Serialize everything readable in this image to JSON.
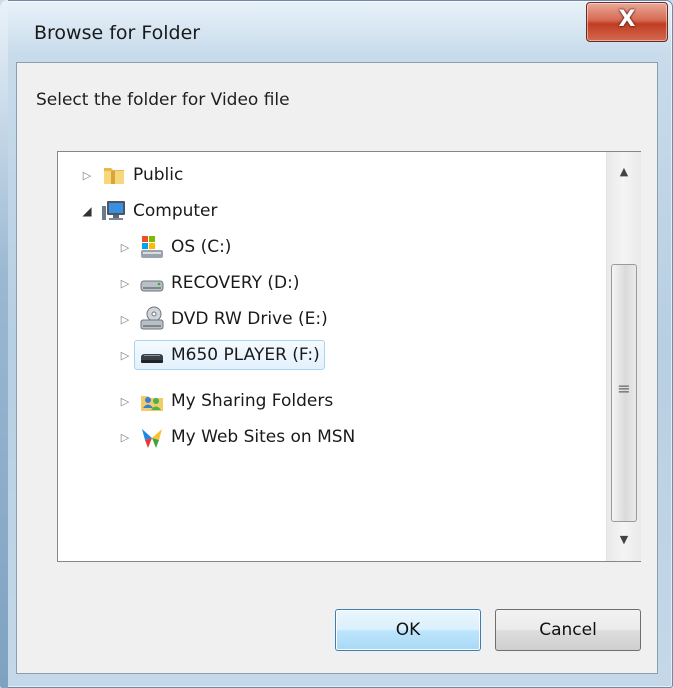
{
  "window": {
    "title": "Browse for Folder",
    "close_glyph": "X"
  },
  "dialog": {
    "prompt": "Select the folder for Video file"
  },
  "tree": {
    "items": [
      {
        "label": "Public",
        "icon": "folder-icon",
        "expander": "collapsed",
        "level": 0
      },
      {
        "label": "Computer",
        "icon": "computer-icon",
        "expander": "expanded",
        "level": 0
      },
      {
        "label": "OS (C:)",
        "icon": "windows-drive-icon",
        "expander": "collapsed",
        "level": 1
      },
      {
        "label": "RECOVERY (D:)",
        "icon": "hard-drive-icon",
        "expander": "collapsed",
        "level": 1
      },
      {
        "label": "DVD RW Drive (E:)",
        "icon": "dvd-drive-icon",
        "expander": "collapsed",
        "level": 1
      },
      {
        "label": "M650 PLAYER (F:)",
        "icon": "removable-drive-icon",
        "expander": "collapsed",
        "level": 1,
        "selected": true
      },
      {
        "label": "My Sharing Folders",
        "icon": "sharing-folders-icon",
        "expander": "collapsed",
        "level": 1
      },
      {
        "label": "My Web Sites on MSN",
        "icon": "msn-butterfly-icon",
        "expander": "collapsed",
        "level": 1
      }
    ]
  },
  "buttons": {
    "ok_label": "OK",
    "cancel_label": "Cancel"
  },
  "colors": {
    "selection_border": "#a9d3f5",
    "close_button": "#c03d22",
    "default_button_border": "#3c7fb1"
  }
}
